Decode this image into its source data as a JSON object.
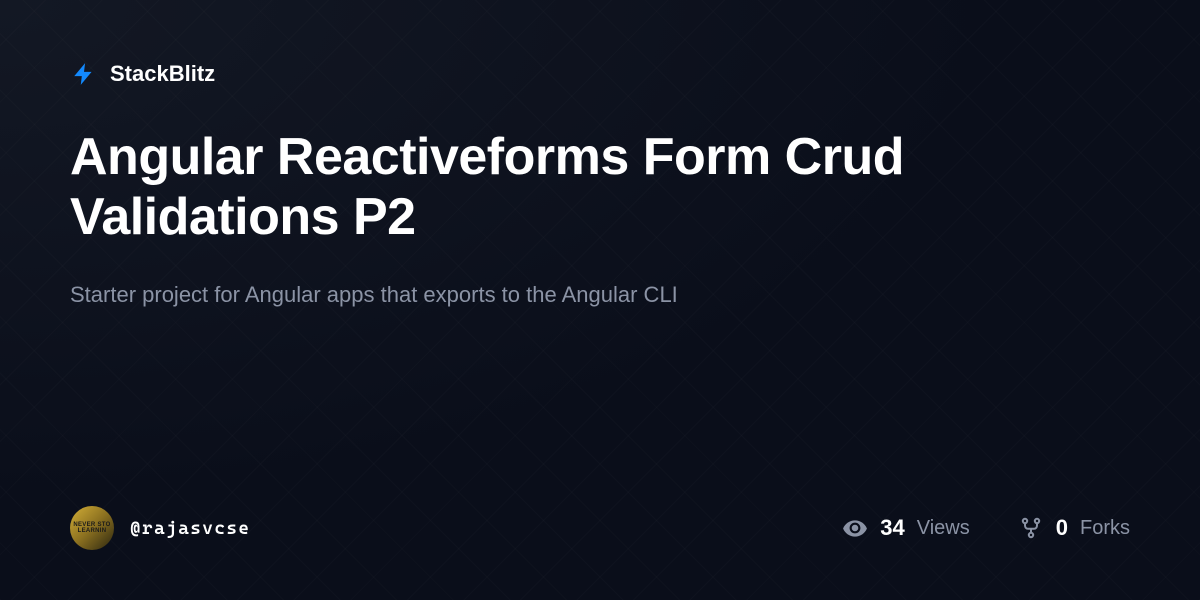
{
  "brand": {
    "name": "StackBlitz"
  },
  "project": {
    "title": "Angular Reactiveforms Form Crud Validations P2",
    "description": "Starter project for Angular apps that exports to the Angular CLI"
  },
  "author": {
    "username": "@rajasvcse",
    "avatar_text_line1": "NEVER STO",
    "avatar_text_line2": "LEARNIN"
  },
  "stats": {
    "views": {
      "value": "34",
      "label": "Views"
    },
    "forks": {
      "value": "0",
      "label": "Forks"
    }
  }
}
